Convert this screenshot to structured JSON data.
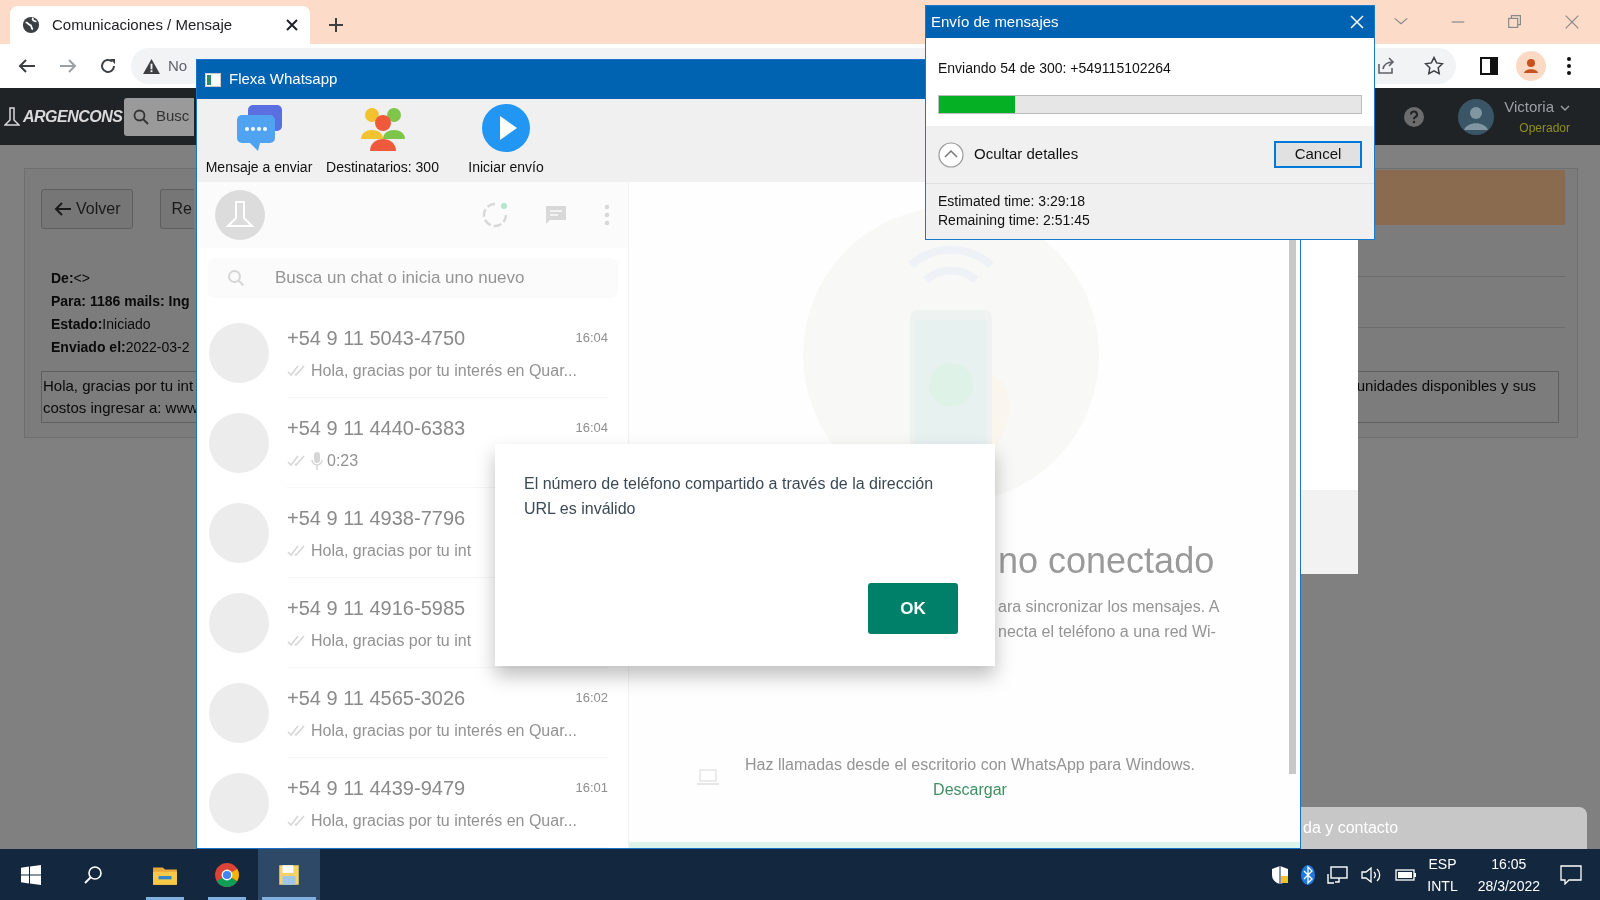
{
  "browser": {
    "tab_title": "Comunicaciones / Mensaje",
    "address": "No"
  },
  "page": {
    "brand": "ARGENCONS",
    "search_placeholder": "Busc",
    "user": {
      "name": "Victoria",
      "role": "Operador"
    },
    "buttons": [
      {
        "label": "Volver",
        "kind": "back"
      },
      {
        "label": "Re",
        "kind": "plain"
      }
    ],
    "fields": [
      {
        "label": "De:",
        "value": "<>",
        "bold_value": false
      },
      {
        "label": "Para:",
        "value": "1186 mails: Ing",
        "bold_value": true
      },
      {
        "label": "Estado:",
        "value": "Iniciado",
        "bold_value": false
      },
      {
        "label": "Enviado el:",
        "value": "2022-03-2",
        "bold_value": false
      }
    ],
    "message_lines": [
      "Hola, gracias por tu int",
      "costos ingresar a: www"
    ],
    "message_right": "unidades disponibles y sus",
    "footer_chip": "da y contacto"
  },
  "flexa": {
    "title": "Flexa Whatsapp",
    "toolbar": [
      {
        "label": "Mensaje a enviar",
        "kind": "message"
      },
      {
        "label": "Destinatarios: 300",
        "kind": "recipients"
      },
      {
        "label": "Iniciar envío",
        "kind": "start"
      }
    ],
    "whatsapp": {
      "search_placeholder": "Busca un chat o inicia uno nuevo",
      "chats": [
        {
          "name": "+54 9 11 5043-4750",
          "time": "16:04",
          "preview": "Hola, gracias por tu interés en Quar...",
          "kind": "text"
        },
        {
          "name": "+54 9 11 4440-6383",
          "time": "16:04",
          "preview": "0:23",
          "kind": "voice"
        },
        {
          "name": "+54 9 11 4938-7796",
          "preview": "Hola, gracias por tu int",
          "kind": "text"
        },
        {
          "name": "+54 9 11 4916-5985",
          "preview": "Hola, gracias por tu int",
          "kind": "text"
        },
        {
          "name": "+54 9 11 4565-3026",
          "time": "16:02",
          "preview": "Hola, gracias por tu interés en Quar...",
          "kind": "text"
        },
        {
          "name": "+54 9 11 4439-9479",
          "time": "16:01",
          "preview": "Hola, gracias por tu interés en Quar...",
          "kind": "text"
        }
      ],
      "title_partial": "no conectado",
      "body_lines": [
        "ara sincronizar los mensajes. A",
        "necta el teléfono a una red Wi-"
      ],
      "calls_text": "Haz llamadas desde el escritorio con WhatsApp para Windows.",
      "download_link": "Descargar"
    },
    "alert": {
      "message": "El número de teléfono compartido a través de la dirección URL es inválido",
      "button": "OK"
    }
  },
  "progress_dialog": {
    "title": "Envío de mensajes",
    "status": "Enviando 54 de 300: +549115102264",
    "level": 0.18,
    "details_toggle": "Ocultar detalles",
    "expanded": true,
    "cancel": "Cancel",
    "estimated": "Estimated time: 3:29:18",
    "remaining": "Remaining time: 2:51:45"
  },
  "taskbar": {
    "apps": [
      {
        "kind": "explorer",
        "selected": false
      },
      {
        "kind": "chrome",
        "selected": false
      },
      {
        "kind": "flexa",
        "selected": true
      }
    ],
    "language": "ESP",
    "layout": "INTL",
    "time": "16:05",
    "date": "28/3/2022"
  }
}
